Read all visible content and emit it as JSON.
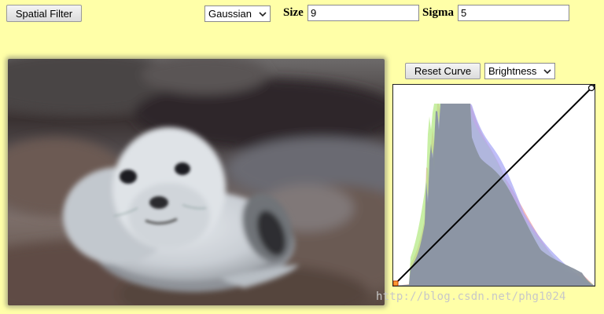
{
  "toolbar": {
    "spatial_filter_label": "Spatial Filter",
    "filter_type": {
      "selected": "Gaussian"
    },
    "size": {
      "label": "Size",
      "value": "9"
    },
    "sigma": {
      "label": "Sigma",
      "value": "5"
    }
  },
  "photo": {
    "subject": "blurred seal pup on rocks"
  },
  "curve_panel": {
    "reset_label": "Reset Curve",
    "channel": {
      "selected": "Brightness"
    }
  },
  "colors": {
    "background": "#ffffa8",
    "hist_red": "#f4a0a0",
    "hist_green": "#b6ea86",
    "hist_blue": "#a8a8f6",
    "hist_gray": "#8a93a0"
  },
  "icons": {
    "dropdown": "chevron-down-icon",
    "curve_point": "control-point-icon"
  },
  "watermark": "http://blog.csdn.net/phg1024"
}
